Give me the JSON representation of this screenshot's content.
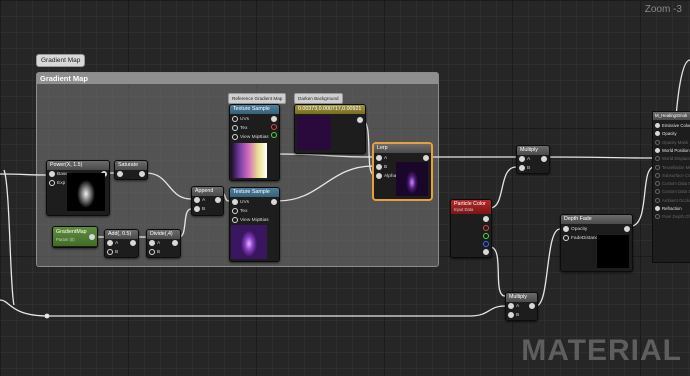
{
  "zoom_label": "Zoom -3",
  "watermark": "MATERIAL",
  "comment": {
    "tab_label": "Gradient Map",
    "title": "Gradient Map"
  },
  "tags": {
    "reference": "Reference Gradient Map",
    "darken": "Darken Background"
  },
  "nodes": {
    "power": {
      "title": "Power(X, 1.5)",
      "pins": [
        "Base",
        "Exp"
      ]
    },
    "saturate": {
      "title": "Saturate"
    },
    "append": {
      "title": "Append",
      "pins": [
        "A",
        "B"
      ]
    },
    "texture_top": {
      "title": "Texture Sample",
      "pins": [
        "UVs",
        "Tex",
        "View MipBias"
      ]
    },
    "texture_bottom": {
      "title": "Texture Sample",
      "pins": [
        "UVs",
        "Tex",
        "View MipBias"
      ]
    },
    "constant3": {
      "title": "0.00373,0.000717,0.00921"
    },
    "lerp": {
      "title": "Lerp",
      "pins": [
        "A",
        "B",
        "Alpha"
      ]
    },
    "gradient_param": {
      "title": "GradientMap",
      "subtitle": "Param (0)"
    },
    "add": {
      "title": "Add(, 0.5)",
      "pins": [
        "A",
        "B"
      ]
    },
    "divide": {
      "title": "Divide(,4)",
      "pins": [
        "A",
        "B"
      ]
    },
    "multiply_top": {
      "title": "Multiply",
      "pins": [
        "A",
        "B"
      ]
    },
    "particle_color": {
      "title": "Particle Color",
      "subtitle": "Input Data"
    },
    "depth_fade": {
      "title": "Depth Fade",
      "pins": [
        "Opacity",
        "FadeDistance"
      ]
    },
    "multiply_bottom": {
      "title": "Multiply",
      "pins": [
        "A",
        "B"
      ]
    }
  },
  "result_node": {
    "title": "M_HealingSmok",
    "inputs": [
      {
        "label": "Emissive Color",
        "active": true
      },
      {
        "label": "Opacity",
        "active": true
      },
      {
        "label": "Opacity Mask",
        "active": false
      },
      {
        "label": "World Position Offset",
        "active": true
      },
      {
        "label": "World Displacement",
        "active": false
      },
      {
        "label": "Tessellation Multiplier",
        "active": false
      },
      {
        "label": "Subsurface Color",
        "active": false
      },
      {
        "label": "Custom Data 0",
        "active": false
      },
      {
        "label": "Custom Data 1",
        "active": false
      },
      {
        "label": "Ambient Occlusion",
        "active": false
      },
      {
        "label": "Refraction",
        "active": true
      },
      {
        "label": "Pixel Depth Offset",
        "active": false
      }
    ]
  }
}
